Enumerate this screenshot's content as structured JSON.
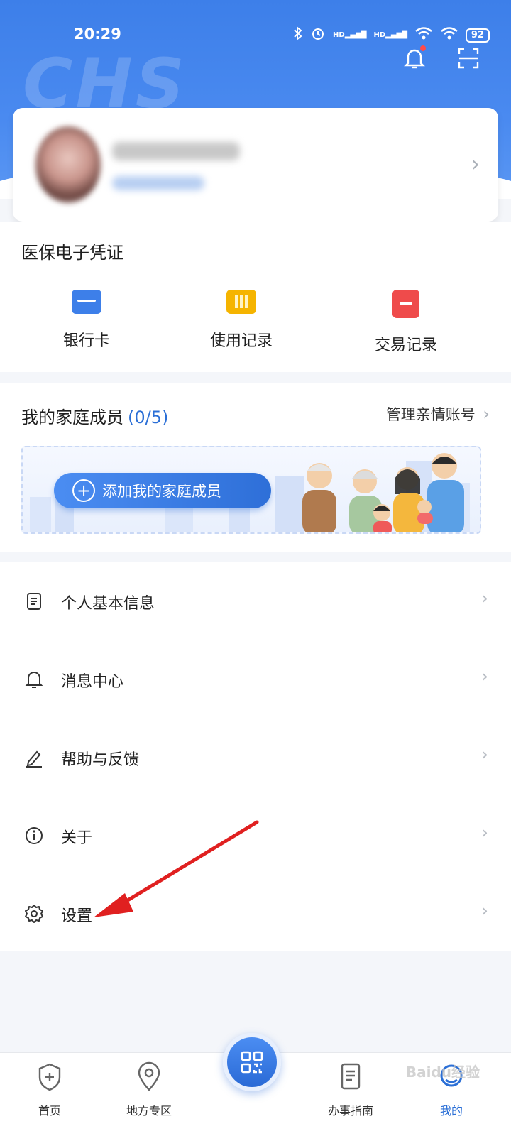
{
  "status_bar": {
    "time": "20:29",
    "battery": "92",
    "signal1": "HD",
    "signal2": "HD"
  },
  "brand_mark": "CHS",
  "voucher": {
    "title": "医保电子凭证",
    "items": [
      {
        "label": "银行卡",
        "icon": "bank-card-icon",
        "color": "#3d7fe9"
      },
      {
        "label": "使用记录",
        "icon": "usage-record-icon",
        "color": "#f5b400"
      },
      {
        "label": "交易记录",
        "icon": "transaction-record-icon",
        "color": "#ef4b4b"
      }
    ]
  },
  "family": {
    "title": "我的家庭成员",
    "count": "(0/5)",
    "manage_label": "管理亲情账号",
    "add_label": "添加我的家庭成员"
  },
  "menu": [
    {
      "label": "个人基本信息",
      "icon": "document-icon"
    },
    {
      "label": "消息中心",
      "icon": "bell-icon"
    },
    {
      "label": "帮助与反馈",
      "icon": "pen-icon"
    },
    {
      "label": "关于",
      "icon": "info-icon"
    },
    {
      "label": "设置",
      "icon": "gear-icon"
    }
  ],
  "bottom_nav": [
    {
      "label": "首页",
      "icon": "home-shield-icon"
    },
    {
      "label": "地方专区",
      "icon": "location-pin-icon"
    },
    {
      "label": "办事指南",
      "icon": "guide-document-icon"
    },
    {
      "label": "我的",
      "icon": "profile-icon",
      "active": true
    }
  ],
  "colors": {
    "primary": "#2b6fd6",
    "header": "#4a8af0",
    "annotation_arrow": "#e02020"
  },
  "watermark": "Baidu经验"
}
